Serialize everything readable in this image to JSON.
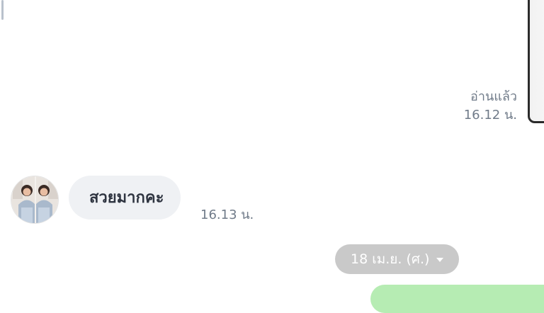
{
  "chat": {
    "read_status": {
      "label": "อ่านแล้ว",
      "time": "16.12 น."
    },
    "incoming_message": {
      "text": "สวยมากคะ",
      "time": "16.13 น."
    },
    "date_separator": {
      "label": "18 เม.ย. (ศ.)",
      "icon": "chevron-down-icon"
    }
  },
  "colors": {
    "incoming_bubble": "#eff1f4",
    "date_pill": "#c9c9c9",
    "outgoing_bubble": "#b6ecb3",
    "meta_text": "#707b89"
  }
}
